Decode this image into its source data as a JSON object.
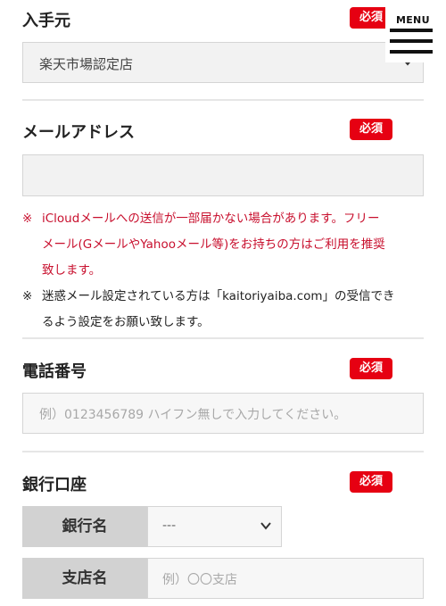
{
  "source": {
    "label": "入手元",
    "required": "必須",
    "selected": "楽天市場認定店"
  },
  "email": {
    "label": "メールアドレス",
    "required": "必須",
    "value": "",
    "notes": [
      {
        "mark": "※",
        "lines": [
          "iCloudメールへの送信が一部届かない場合があります。フリー",
          "メール(GメールやYahooメール等)をお持ちの方はご利用を推奨",
          "致します。"
        ]
      },
      {
        "mark": "※",
        "lines": [
          "迷惑メール設定されている方は「kaitoriyaiba.com」の受信でき",
          "るよう設定をお願い致します。"
        ]
      }
    ]
  },
  "phone": {
    "label": "電話番号",
    "required": "必須",
    "placeholder": "例）0123456789 ハイフン無しで入力してください。"
  },
  "bank": {
    "label": "銀行口座",
    "required": "必須",
    "bank_name_label": "銀行名",
    "bank_name_value": "---",
    "branch_label": "支店名",
    "branch_placeholder": "例）〇〇支店"
  },
  "menu": {
    "label": "MENU"
  },
  "colors": {
    "required_bg": "#e60012",
    "note_red": "#c8102e"
  }
}
